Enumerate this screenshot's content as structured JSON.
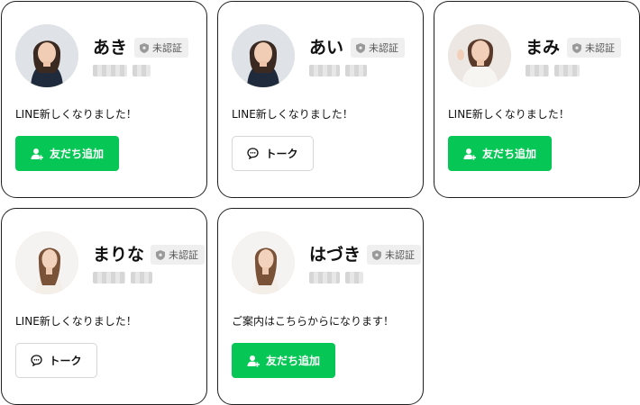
{
  "badge_label": "未認証",
  "icons": {
    "badge": "shield-icon",
    "add": "add-friend-icon",
    "talk": "chat-bubble-icon"
  },
  "colors": {
    "line_green": "#06c755",
    "badge_bg": "#efefef",
    "card_border": "#1f1f1f"
  },
  "cards": [
    {
      "name": "あき",
      "message": "LINE新しくなりました！",
      "button": "友だち追加"
    },
    {
      "name": "あい",
      "message": "LINE新しくなりました！",
      "button": "トーク"
    },
    {
      "name": "まみ",
      "message": "LINE新しくなりました！",
      "button": "友だち追加"
    },
    {
      "name": "まりな",
      "message": "LINE新しくなりました！",
      "button": "トーク"
    },
    {
      "name": "はづき",
      "message": "ご案内はこちらからになります！",
      "button": "友だち追加"
    }
  ]
}
